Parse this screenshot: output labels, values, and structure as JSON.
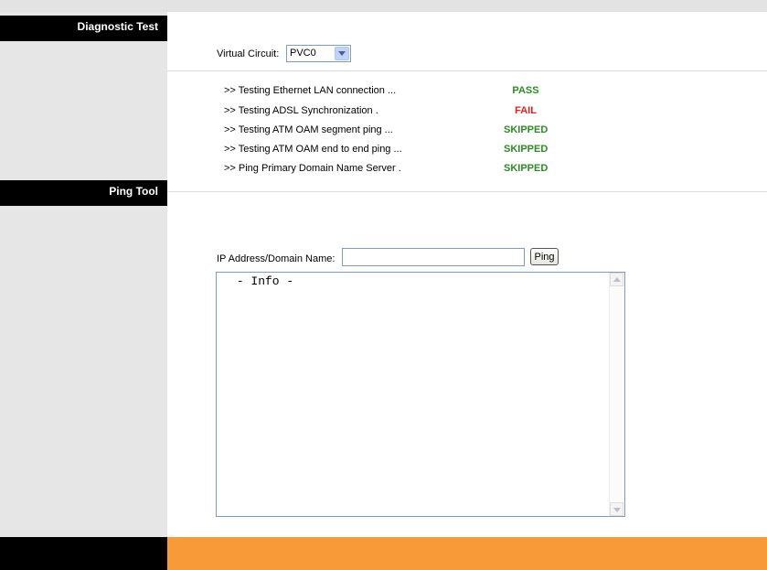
{
  "sections": {
    "diagnostic_title": "Diagnostic Test",
    "ping_title": "Ping Tool"
  },
  "virtual_circuit": {
    "label": "Virtual Circuit:",
    "selected": "PVC0"
  },
  "tests": [
    {
      "name": ">> Testing Ethernet LAN connection ...",
      "result": "PASS",
      "status": "pass"
    },
    {
      "name": ">> Testing ADSL Synchronization .",
      "result": "FAIL",
      "status": "fail"
    },
    {
      "name": ">> Testing ATM OAM segment ping ...",
      "result": "SKIPPED",
      "status": "pass"
    },
    {
      "name": ">> Testing ATM OAM end to end ping ...",
      "result": "SKIPPED",
      "status": "pass"
    },
    {
      "name": ">> Ping Primary Domain Name Server .",
      "result": "SKIPPED",
      "status": "pass"
    }
  ],
  "ping": {
    "ip_label": "IP Address/Domain Name:",
    "ip_value": "",
    "button_label": "Ping",
    "info_text": " - Info -"
  },
  "colors": {
    "pass": "#2e8b25",
    "fail": "#e02020",
    "footer_accent": "#f99a38"
  }
}
